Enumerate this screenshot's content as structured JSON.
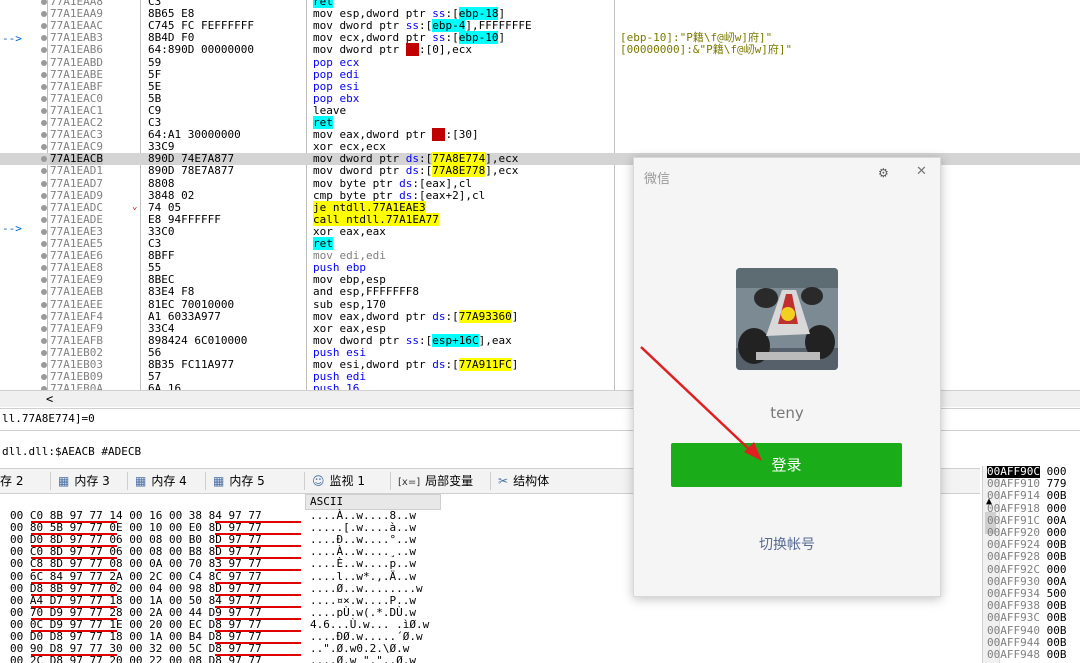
{
  "disasm": {
    "rows": [
      {
        "addr": "77A1EAA8",
        "bytes": "C3",
        "ins": [
          {
            "t": "ret",
            "c": "hl-c"
          }
        ],
        "cmt": ""
      },
      {
        "addr": "77A1EAA9",
        "bytes": "8B65 E8",
        "ins": [
          {
            "t": "mov esp,dword ptr "
          },
          {
            "t": "ss",
            "c": "kw-blue"
          },
          {
            "t": ":["
          },
          {
            "t": "ebp-18",
            "c": "hl-c"
          },
          {
            "t": "]"
          }
        ],
        "cmt": ""
      },
      {
        "addr": "77A1EAAC",
        "bytes": "C745 FC FEFFFFFF",
        "ins": [
          {
            "t": "mov dword ptr "
          },
          {
            "t": "ss",
            "c": "kw-blue"
          },
          {
            "t": ":["
          },
          {
            "t": "ebp-4",
            "c": "hl-c"
          },
          {
            "t": "],FFFFFFFE"
          }
        ],
        "cmt": ""
      },
      {
        "addr": "77A1EAB3",
        "bytes": "8B4D F0",
        "ins": [
          {
            "t": "mov ecx,dword ptr "
          },
          {
            "t": "ss",
            "c": "kw-blue"
          },
          {
            "t": ":["
          },
          {
            "t": "ebp-10",
            "c": "hl-c"
          },
          {
            "t": "]"
          }
        ],
        "cmt": "[ebp-10]:\"P籍\\f@屻w]府]\""
      },
      {
        "addr": "77A1EAB6",
        "bytes": "64:890D 00000000",
        "ins": [
          {
            "t": "mov dword ptr "
          },
          {
            "t": "fs",
            "c": "hl-r"
          },
          {
            "t": ":[0],ecx"
          }
        ],
        "cmt": "[00000000]:&\"P籍\\f@屻w]府]\""
      },
      {
        "addr": "77A1EABD",
        "bytes": "59",
        "ins": [
          {
            "t": "pop ecx",
            "c": "kw-blue"
          }
        ],
        "cmt": ""
      },
      {
        "addr": "77A1EABE",
        "bytes": "5F",
        "ins": [
          {
            "t": "pop edi",
            "c": "kw-blue"
          }
        ],
        "cmt": ""
      },
      {
        "addr": "77A1EABF",
        "bytes": "5E",
        "ins": [
          {
            "t": "pop esi",
            "c": "kw-blue"
          }
        ],
        "cmt": ""
      },
      {
        "addr": "77A1EAC0",
        "bytes": "5B",
        "ins": [
          {
            "t": "pop ebx",
            "c": "kw-blue"
          }
        ],
        "cmt": ""
      },
      {
        "addr": "77A1EAC1",
        "bytes": "C9",
        "ins": [
          {
            "t": "leave"
          }
        ],
        "cmt": ""
      },
      {
        "addr": "77A1EAC2",
        "bytes": "C3",
        "ins": [
          {
            "t": "ret",
            "c": "hl-c"
          }
        ],
        "cmt": ""
      },
      {
        "addr": "77A1EAC3",
        "bytes": "64:A1 30000000",
        "ins": [
          {
            "t": "mov eax,dword ptr "
          },
          {
            "t": "fs",
            "c": "hl-r"
          },
          {
            "t": ":[30]"
          }
        ],
        "cmt": ""
      },
      {
        "addr": "77A1EAC9",
        "bytes": "33C9",
        "ins": [
          {
            "t": "xor ecx,ecx"
          }
        ],
        "cmt": ""
      },
      {
        "addr": "77A1EACB",
        "bytes": "890D 74E7A877",
        "ins": [
          {
            "t": "mov dword ptr "
          },
          {
            "t": "ds",
            "c": "kw-blue"
          },
          {
            "t": ":["
          },
          {
            "t": "77A8E774",
            "c": "hl-y"
          },
          {
            "t": "],ecx"
          }
        ],
        "cmt": "",
        "sel": true
      },
      {
        "addr": "77A1EAD1",
        "bytes": "890D 78E7A877",
        "ins": [
          {
            "t": "mov dword ptr "
          },
          {
            "t": "ds",
            "c": "kw-blue"
          },
          {
            "t": ":["
          },
          {
            "t": "77A8E778",
            "c": "hl-y"
          },
          {
            "t": "],ecx"
          }
        ],
        "cmt": ""
      },
      {
        "addr": "77A1EAD7",
        "bytes": "8808",
        "ins": [
          {
            "t": "mov byte ptr "
          },
          {
            "t": "ds",
            "c": "kw-blue"
          },
          {
            "t": ":[eax],cl"
          }
        ],
        "cmt": ""
      },
      {
        "addr": "77A1EAD9",
        "bytes": "3848 02",
        "ins": [
          {
            "t": "cmp byte ptr "
          },
          {
            "t": "ds",
            "c": "kw-blue"
          },
          {
            "t": ":[eax+2],cl"
          }
        ],
        "cmt": ""
      },
      {
        "addr": "77A1EADC",
        "bytes": "74 05",
        "ins": [
          {
            "t": "je ntdll.77A1EAE3",
            "c": "hl-y"
          }
        ],
        "cmt": ""
      },
      {
        "addr": "77A1EADE",
        "bytes": "E8 94FFFFFF",
        "ins": [
          {
            "t": "call ntdll.77A1EA77",
            "c": "hl-y"
          }
        ],
        "cmt": ""
      },
      {
        "addr": "77A1EAE3",
        "bytes": "33C0",
        "ins": [
          {
            "t": "xor eax,eax"
          }
        ],
        "cmt": ""
      },
      {
        "addr": "77A1EAE5",
        "bytes": "C3",
        "ins": [
          {
            "t": "ret",
            "c": "hl-c"
          }
        ],
        "cmt": ""
      },
      {
        "addr": "77A1EAE6",
        "bytes": "8BFF",
        "ins": [
          {
            "t": "mov edi,edi",
            "c": "kw-gray"
          }
        ],
        "cmt": ""
      },
      {
        "addr": "77A1EAE8",
        "bytes": "55",
        "ins": [
          {
            "t": "push ebp",
            "c": "kw-blue"
          }
        ],
        "cmt": ""
      },
      {
        "addr": "77A1EAE9",
        "bytes": "8BEC",
        "ins": [
          {
            "t": "mov ebp,esp"
          }
        ],
        "cmt": ""
      },
      {
        "addr": "77A1EAEB",
        "bytes": "83E4 F8",
        "ins": [
          {
            "t": "and esp,FFFFFFF8"
          }
        ],
        "cmt": ""
      },
      {
        "addr": "77A1EAEE",
        "bytes": "81EC 70010000",
        "ins": [
          {
            "t": "sub esp,170"
          }
        ],
        "cmt": ""
      },
      {
        "addr": "77A1EAF4",
        "bytes": "A1 6033A977",
        "ins": [
          {
            "t": "mov eax,dword ptr "
          },
          {
            "t": "ds",
            "c": "kw-blue"
          },
          {
            "t": ":["
          },
          {
            "t": "77A93360",
            "c": "hl-y"
          },
          {
            "t": "]"
          }
        ],
        "cmt": ""
      },
      {
        "addr": "77A1EAF9",
        "bytes": "33C4",
        "ins": [
          {
            "t": "xor eax,esp"
          }
        ],
        "cmt": ""
      },
      {
        "addr": "77A1EAFB",
        "bytes": "898424 6C010000",
        "ins": [
          {
            "t": "mov dword ptr "
          },
          {
            "t": "ss",
            "c": "kw-blue"
          },
          {
            "t": ":["
          },
          {
            "t": "esp+16C",
            "c": "hl-c"
          },
          {
            "t": "],eax"
          }
        ],
        "cmt": ""
      },
      {
        "addr": "77A1EB02",
        "bytes": "56",
        "ins": [
          {
            "t": "push esi",
            "c": "kw-blue"
          }
        ],
        "cmt": ""
      },
      {
        "addr": "77A1EB03",
        "bytes": "8B35 FC11A977",
        "ins": [
          {
            "t": "mov esi,dword ptr "
          },
          {
            "t": "ds",
            "c": "kw-blue"
          },
          {
            "t": ":["
          },
          {
            "t": "77A911FC",
            "c": "hl-y"
          },
          {
            "t": "]"
          }
        ],
        "cmt": ""
      },
      {
        "addr": "77A1EB09",
        "bytes": "57",
        "ins": [
          {
            "t": "push edi",
            "c": "kw-blue"
          }
        ],
        "cmt": ""
      },
      {
        "addr": "77A1EB0A",
        "bytes": "6A 16",
        "ins": [
          {
            "t": "push 16",
            "c": "kw-blue"
          }
        ],
        "cmt": ""
      }
    ]
  },
  "info": {
    "line1": "ll.77A8E774]=0",
    "line2": "dll.dll:$AEACB #ADECB"
  },
  "tabs": [
    {
      "label": "存 2",
      "icon": ""
    },
    {
      "label": "内存 3",
      "icon": "memory-icon"
    },
    {
      "label": "内存 4",
      "icon": "memory-icon"
    },
    {
      "label": "内存 5",
      "icon": "memory-icon"
    },
    {
      "label": "监视 1",
      "icon": "watch-icon"
    },
    {
      "label": "局部变量",
      "icon": "locals-icon",
      "prefix": "[x=]"
    },
    {
      "label": "结构体",
      "icon": "struct-icon"
    }
  ],
  "dump": {
    "ascii_header": "ASCII",
    "rows": [
      {
        "hex": "00 C0 8B 97 77 14 00 16 00 38 84 97 77",
        "ascii": "....À..w....8..w",
        "u1": true,
        "u2": true
      },
      {
        "hex": "00 80 5B 97 77 0E 00 10 00 E0 8D 97 77",
        "ascii": ".....[.w....à..w",
        "u1": true,
        "u2": true
      },
      {
        "hex": "00 D0 8D 97 77 06 00 08 00 B0 8D 97 77",
        "ascii": "....Ð..w....°..w",
        "u1": true,
        "u2": true
      },
      {
        "hex": "00 C0 8D 97 77 06 00 08 00 B8 8D 97 77",
        "ascii": "....À..w....¸..w",
        "u1": true,
        "u2": true
      },
      {
        "hex": "00 C8 8D 97 77 08 00 0A 00 70 83 97 77",
        "ascii": "....È..w....p..w",
        "u1": true,
        "u2": true
      },
      {
        "hex": "00 6C 84 97 77 2A 00 2C 00 C4 8C 97 77",
        "ascii": "....l..w*.,.Ä..w",
        "u1": true,
        "u2": true
      },
      {
        "hex": "00 D8 8B 97 77 02 00 04 00 98 8D 97 77",
        "ascii": "....Ø..w........w",
        "u1": true,
        "u2": true
      },
      {
        "hex": "00 A4 D7 97 77 18 00 1A 00 50 84 97 77",
        "ascii": "....¤×.w....P..w",
        "u1": true,
        "u2": true
      },
      {
        "hex": "00 70 D9 97 77 28 00 2A 00 44 D9 97 77",
        "ascii": "....pÙ.w(.*.DÙ.w",
        "u1": true,
        "u2": true
      },
      {
        "hex": "00 0C D9 97 77 1E 00 20 00 EC D8 97 77",
        "ascii": "4.6...Ù.w... .ìØ.w",
        "u1": true,
        "u2": true
      },
      {
        "hex": "00 D0 D8 97 77 18 00 1A 00 B4 D8 97 77",
        "ascii": "....ÐØ.w.....´Ø.w",
        "u1": false,
        "u2": true
      },
      {
        "hex": "00 90 D8 97 77 30 00 32 00 5C D8 97 77",
        "ascii": "..\".Ø.w0.2.\\Ø.w",
        "u1": true,
        "u2": true
      },
      {
        "hex": "00 2C D8 97 77 20 00 22 00 08 D8 97 77",
        "ascii": "...,Ø.w \".\"..Ø.w",
        "u1": true,
        "u2": true
      }
    ]
  },
  "stack": {
    "rows": [
      {
        "addr": "00AFF90C",
        "val": "000",
        "top": true
      },
      {
        "addr": "00AFF910",
        "val": "779"
      },
      {
        "addr": "00AFF914",
        "val": "00B"
      },
      {
        "addr": "00AFF918",
        "val": "000"
      },
      {
        "addr": "00AFF91C",
        "val": "00A"
      },
      {
        "addr": "00AFF920",
        "val": "000"
      },
      {
        "addr": "00AFF924",
        "val": "00B"
      },
      {
        "addr": "00AFF928",
        "val": "00B"
      },
      {
        "addr": "00AFF92C",
        "val": "000"
      },
      {
        "addr": "00AFF930",
        "val": "00A"
      },
      {
        "addr": "00AFF934",
        "val": "500"
      },
      {
        "addr": "00AFF938",
        "val": "00B"
      },
      {
        "addr": "00AFF93C",
        "val": "00B"
      },
      {
        "addr": "00AFF940",
        "val": "00B"
      },
      {
        "addr": "00AFF944",
        "val": "00B"
      },
      {
        "addr": "00AFF948",
        "val": "00B"
      }
    ]
  },
  "dialog": {
    "title": "微信",
    "username": "teny",
    "login_label": "登录",
    "switch_label": "切换帐号",
    "login_color": "#1aad19",
    "link_color": "#576b95"
  },
  "annotation": {
    "arrow_color": "#e02020"
  }
}
